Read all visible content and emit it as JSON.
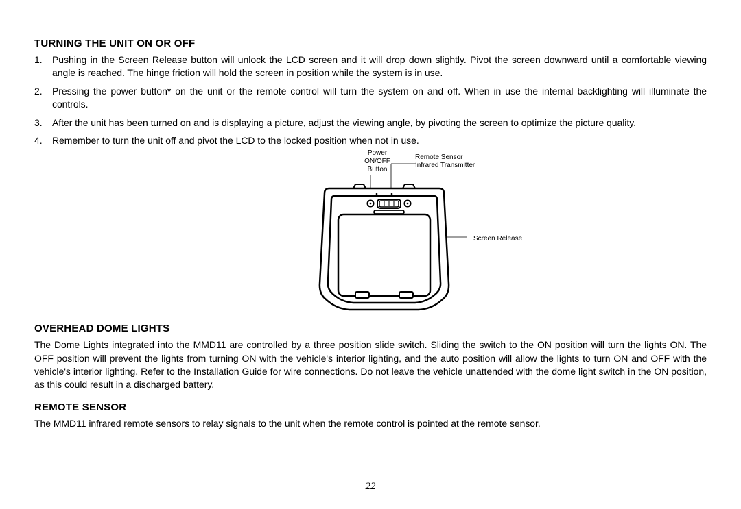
{
  "page_number": "22",
  "section1": {
    "title": "TURNING THE UNIT ON OR OFF",
    "items": [
      "Pushing in the Screen Release button will unlock the LCD screen and it will drop down slightly. Pivot the screen downward until a comfortable viewing angle is reached. The hinge friction will hold the screen in position while the system is in use.",
      "Pressing the power button* on the unit or the remote control will turn the system on and off. When in use the internal backlighting will illuminate the controls.",
      "After the unit has been turned on and is displaying a picture, adjust the viewing angle, by pivoting the screen to optimize the picture quality.",
      "Remember to turn the unit off and pivot the LCD to the locked position when not in use."
    ]
  },
  "figure": {
    "label_power": "Power\nON/OFF\nButton",
    "label_sensor": "Remote Sensor\nInfrared Transmitter",
    "label_release": "Screen Release"
  },
  "section2": {
    "title": "OVERHEAD DOME LIGHTS",
    "body": "The Dome Lights integrated into the MMD11 are controlled by a three position slide switch. Sliding the switch to the ON position will turn the lights ON. The OFF position will prevent the lights from turning ON with the vehicle's interior lighting, and the auto position will allow the lights to turn ON and OFF with the vehicle's interior lighting. Refer to the Installation Guide for wire connections. Do not leave the vehicle unattended with the dome light switch in the ON position, as this could result in a discharged battery."
  },
  "section3": {
    "title": "REMOTE SENSOR",
    "body": "The MMD11 infrared remote sensors to relay signals to the unit when the remote control is pointed at the remote sensor."
  }
}
